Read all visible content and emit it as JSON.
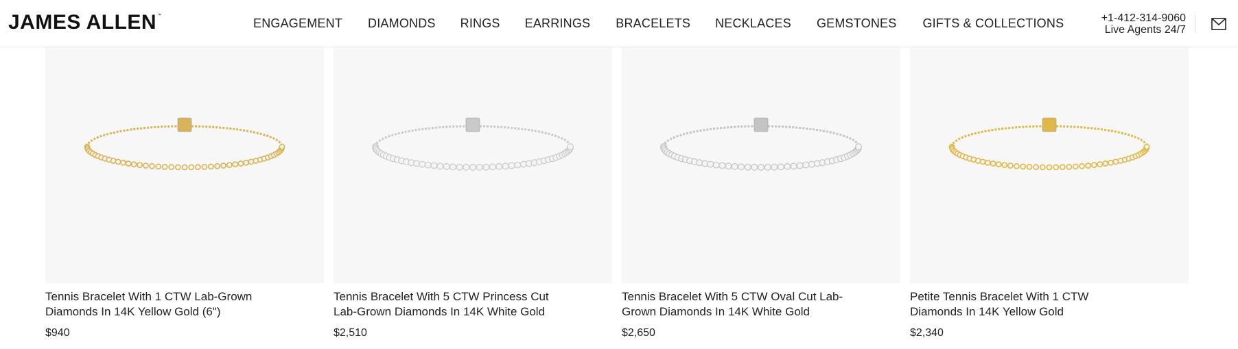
{
  "brand": {
    "name": "JAMES ALLEN",
    "trademark": "™"
  },
  "nav": [
    {
      "label": "ENGAGEMENT"
    },
    {
      "label": "DIAMONDS"
    },
    {
      "label": "RINGS"
    },
    {
      "label": "EARRINGS"
    },
    {
      "label": "BRACELETS"
    },
    {
      "label": "NECKLACES"
    },
    {
      "label": "GEMSTONES"
    },
    {
      "label": "GIFTS & COLLECTIONS"
    }
  ],
  "contact": {
    "phone": "+1-412-314-9060",
    "agents": "Live Agents 24/7"
  },
  "icons": {
    "mail": "envelope-icon"
  },
  "products": [
    {
      "title": "Tennis Bracelet With 1 CTW Lab-Grown Diamonds In 14K Yellow Gold (6\")",
      "price": "$940",
      "metal": "yellow",
      "color": "#d9b35a"
    },
    {
      "title": "Tennis Bracelet With 5 CTW Princess Cut Lab-Grown Diamonds In 14K White Gold",
      "price": "$2,510",
      "metal": "white",
      "color": "#c9c9c9"
    },
    {
      "title": "Tennis Bracelet With 5 CTW Oval Cut Lab-Grown Diamonds In 14K White Gold",
      "price": "$2,650",
      "metal": "white",
      "color": "#c4c4c4"
    },
    {
      "title": "Petite Tennis Bracelet With 1 CTW Diamonds In 14K Yellow Gold",
      "price": "$2,340",
      "metal": "yellow",
      "color": "#e0b84a"
    }
  ],
  "colors": {
    "image_bg": "#f7f7f7",
    "text": "#222222",
    "border": "#e6e6e6"
  }
}
